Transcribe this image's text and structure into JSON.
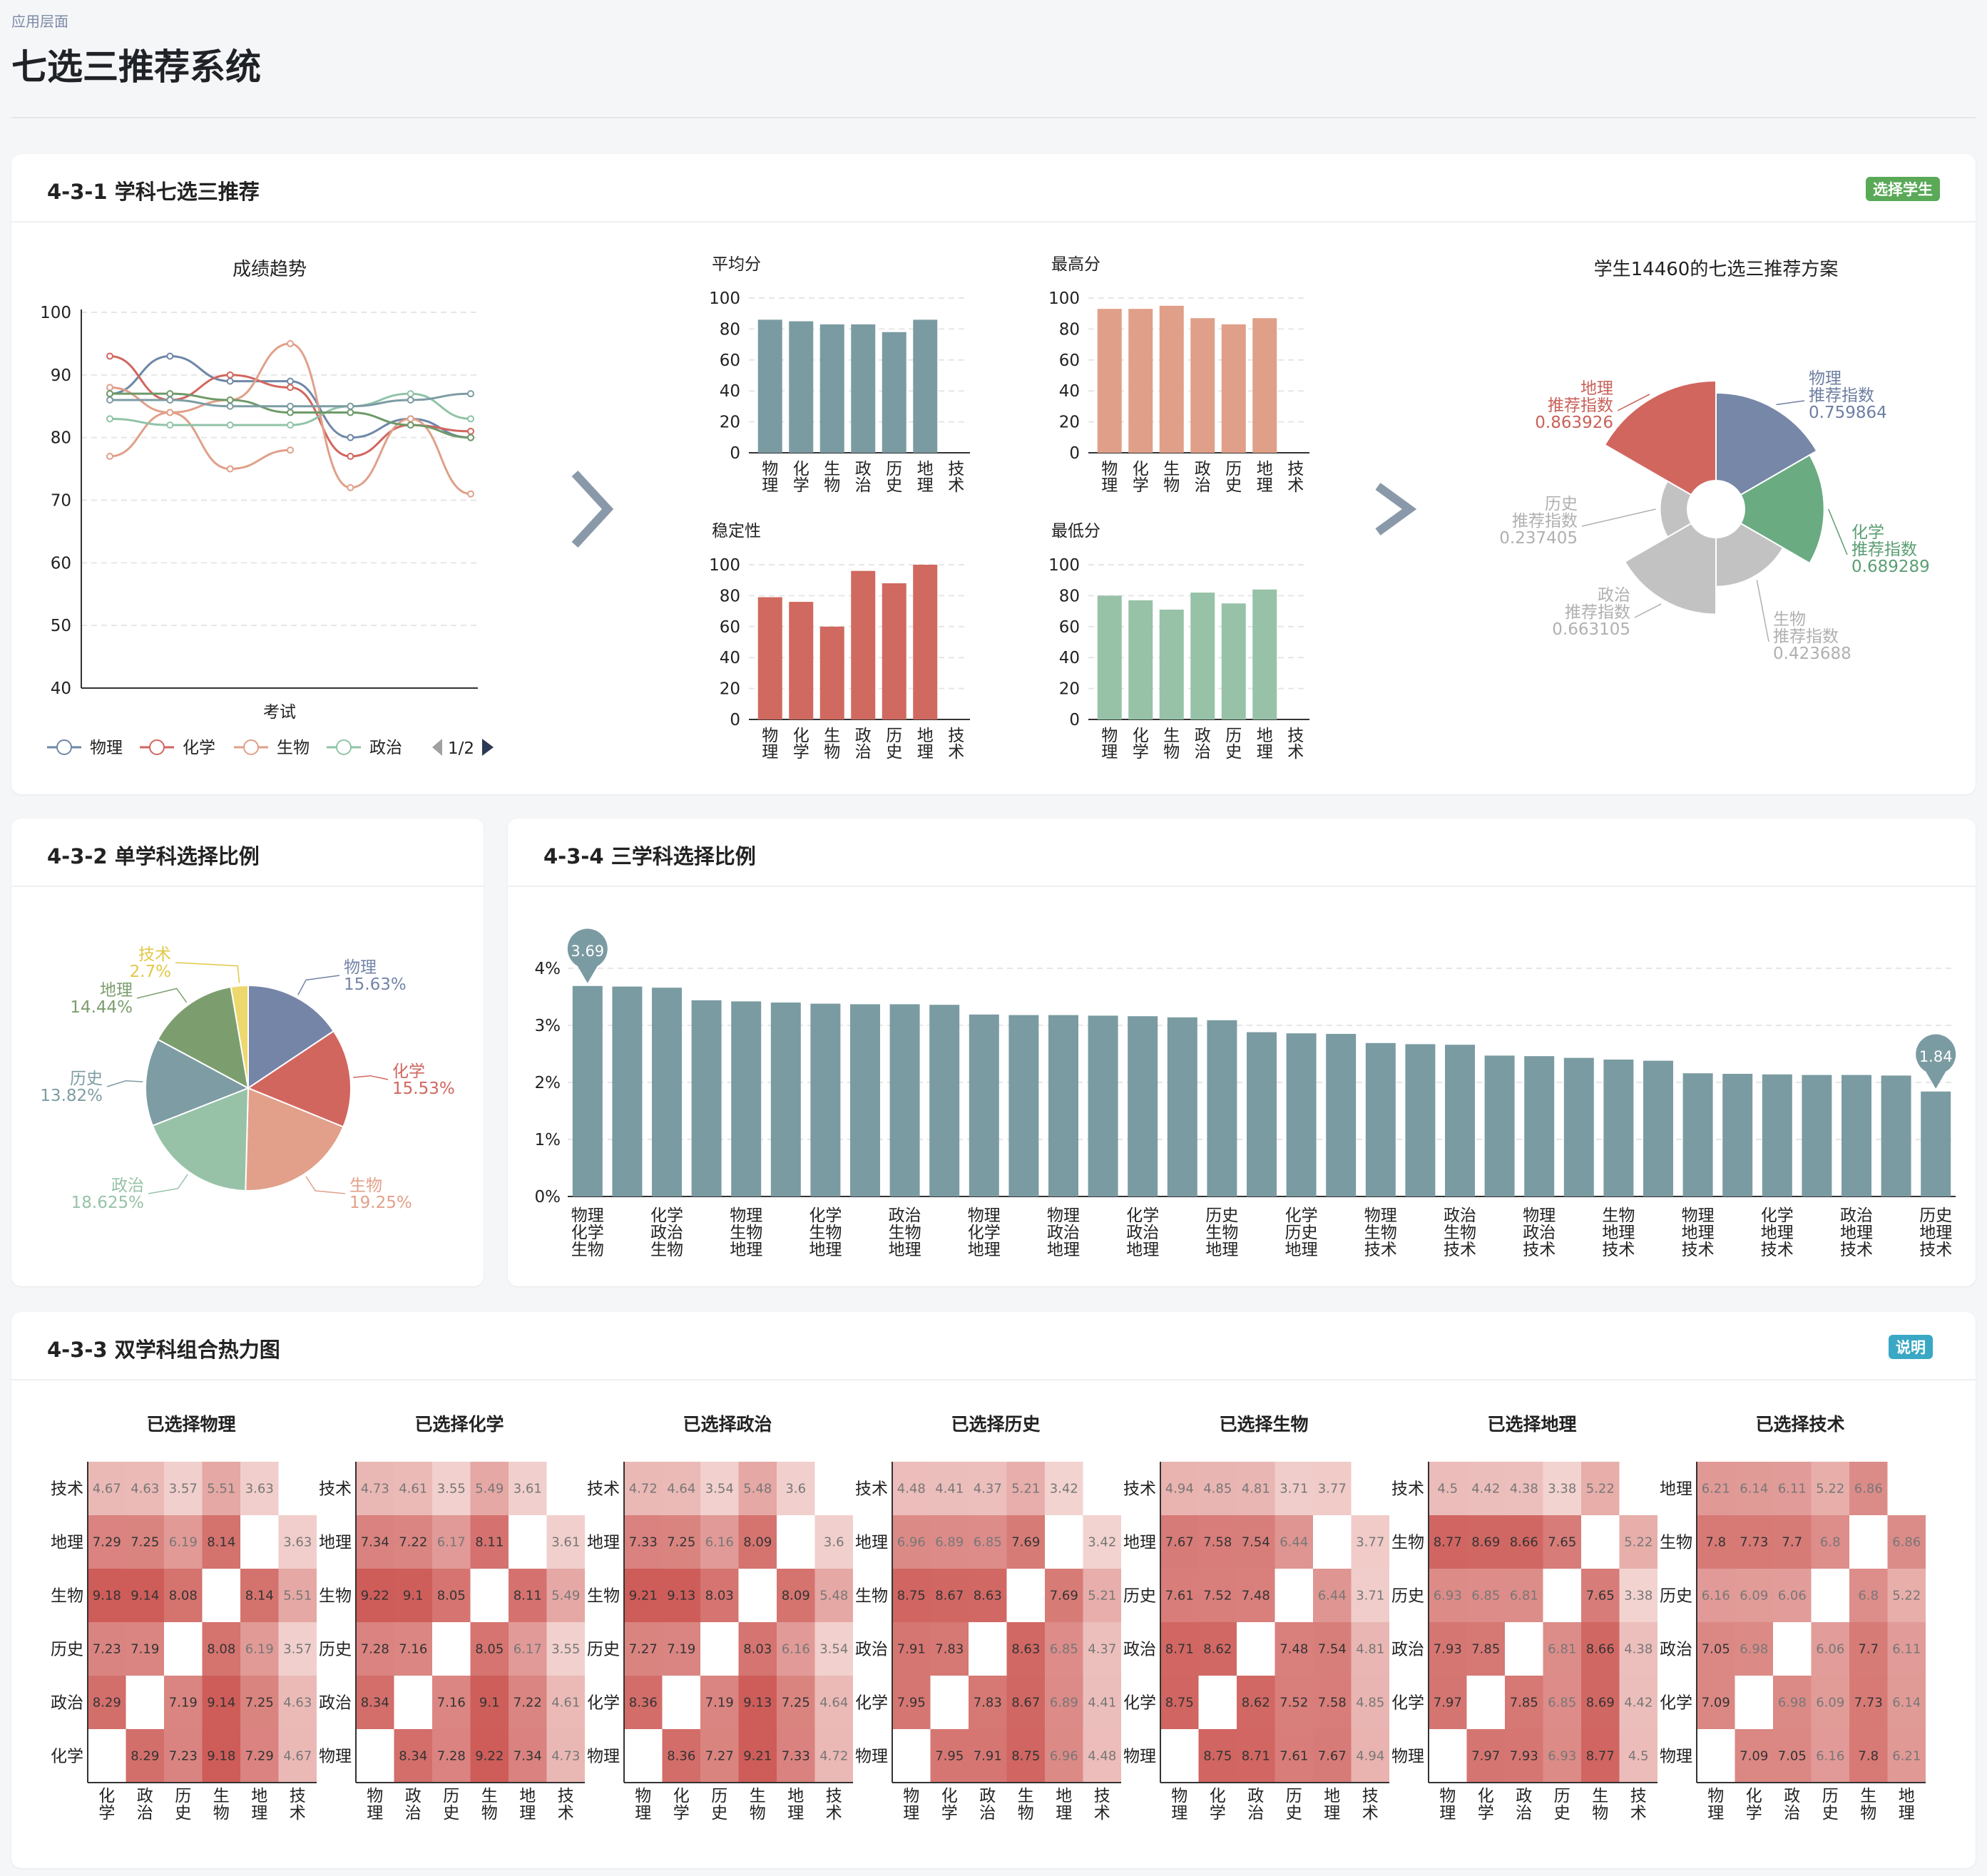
{
  "breadcrumb": "应用层面",
  "page_title": "七选三推荐系统",
  "card1": {
    "title": "4-3-1 学科七选三推荐",
    "badge": "选择学生"
  },
  "card2": {
    "title": "4-3-2 单学科选择比例"
  },
  "card4": {
    "title": "4-3-4 三学科选择比例"
  },
  "card3": {
    "title": "4-3-3 双学科组合热力图",
    "badge": "说明"
  },
  "line_chart": {
    "title": "成绩趋势",
    "xlabel": "考试",
    "legend": [
      "物理",
      "化学",
      "生物",
      "政治"
    ],
    "pager": "1/2"
  },
  "colors": {
    "物理": "#6e87a8",
    "化学": "#d1665f",
    "生物": "#e0a08a",
    "政治": "#90c3a7",
    "地理": "#6e9968",
    "历史": "#7d9ca3",
    "技术": "#ecd86d",
    "steel": "#7d9ca3"
  },
  "chart_data": [
    {
      "id": "score-trend",
      "type": "line",
      "title": "成绩趋势",
      "xlabel": "考试",
      "ylim": [
        40,
        100
      ],
      "yticks": [
        40,
        50,
        60,
        70,
        80,
        90,
        100
      ],
      "grid": true,
      "legend_placement": "bottom",
      "series": [
        {
          "name": "物理",
          "values": [
            87,
            93,
            89,
            89,
            80,
            83,
            80
          ]
        },
        {
          "name": "化学",
          "values": [
            93,
            86,
            90,
            88,
            77,
            82,
            81
          ]
        },
        {
          "name": "生物",
          "values": [
            77,
            84,
            75,
            78
          ]
        },
        {
          "name": "政治",
          "values": [
            83,
            82,
            82,
            82,
            85,
            87,
            83
          ]
        },
        {
          "name": "生物",
          "values": [
            88,
            84,
            86,
            95,
            72,
            83,
            71
          ]
        },
        {
          "name": "地理",
          "values": [
            87,
            87,
            86,
            84,
            84,
            82,
            80
          ]
        },
        {
          "name": "历史",
          "values": [
            86,
            86,
            85,
            85,
            85,
            86,
            87
          ]
        }
      ]
    },
    {
      "id": "avg",
      "type": "bar",
      "title": "平均分",
      "categories": [
        "物理",
        "化学",
        "生物",
        "政治",
        "历史",
        "地理",
        "技术"
      ],
      "values": [
        86,
        85,
        83,
        83,
        78,
        86,
        null
      ],
      "ylim": [
        0,
        100
      ],
      "yticks": [
        0,
        20,
        40,
        60,
        80,
        100
      ]
    },
    {
      "id": "max",
      "type": "bar",
      "title": "最高分",
      "categories": [
        "物理",
        "化学",
        "生物",
        "政治",
        "历史",
        "地理",
        "技术"
      ],
      "values": [
        93,
        93,
        95,
        87,
        83,
        87,
        null
      ],
      "ylim": [
        0,
        100
      ],
      "yticks": [
        0,
        20,
        40,
        60,
        80,
        100
      ]
    },
    {
      "id": "stability",
      "type": "bar",
      "title": "稳定性",
      "categories": [
        "物理",
        "化学",
        "生物",
        "政治",
        "历史",
        "地理",
        "技术"
      ],
      "values": [
        79,
        76,
        60,
        96,
        88,
        100,
        null
      ],
      "ylim": [
        0,
        100
      ],
      "yticks": [
        0,
        20,
        40,
        60,
        80,
        100
      ]
    },
    {
      "id": "min",
      "type": "bar",
      "title": "最低分",
      "categories": [
        "物理",
        "化学",
        "生物",
        "政治",
        "历史",
        "地理",
        "技术"
      ],
      "values": [
        80,
        77,
        71,
        82,
        75,
        84,
        null
      ],
      "ylim": [
        0,
        100
      ],
      "yticks": [
        0,
        20,
        40,
        60,
        80,
        100
      ]
    },
    {
      "id": "recommend-rose",
      "type": "pie",
      "title": "学生14460的七选三推荐方案",
      "caption": "推荐指数",
      "slices": [
        {
          "name": "物理",
          "value": 0.759864,
          "label": "0.759864"
        },
        {
          "name": "化学",
          "value": 0.689289,
          "label": "0.689289"
        },
        {
          "name": "生物",
          "value": 0.423688,
          "label": "0.423688"
        },
        {
          "name": "政治",
          "value": 0.663105,
          "label": "0.663105"
        },
        {
          "name": "历史",
          "value": 0.237405,
          "label": "0.237405"
        },
        {
          "name": "地理",
          "value": 0.863926,
          "label": "0.863926"
        }
      ]
    },
    {
      "id": "single-subject",
      "type": "pie",
      "slices": [
        {
          "name": "物理",
          "value": 15.63,
          "label": "15.63%"
        },
        {
          "name": "化学",
          "value": 15.53,
          "label": "15.53%"
        },
        {
          "name": "生物",
          "value": 19.25,
          "label": "19.25%"
        },
        {
          "name": "政治",
          "value": 18.625,
          "label": "18.625%"
        },
        {
          "name": "历史",
          "value": 13.82,
          "label": "13.82%"
        },
        {
          "name": "地理",
          "value": 14.44,
          "label": "14.44%"
        },
        {
          "name": "技术",
          "value": 2.7,
          "label": "2.7%"
        }
      ]
    },
    {
      "id": "triple-subject",
      "type": "bar",
      "ylim": [
        0,
        4
      ],
      "yticks": [
        "0%",
        "1%",
        "2%",
        "3%",
        "4%"
      ],
      "values": [
        3.69,
        3.68,
        3.66,
        3.44,
        3.42,
        3.4,
        3.38,
        3.37,
        3.37,
        3.36,
        3.19,
        3.18,
        3.18,
        3.17,
        3.16,
        3.14,
        3.09,
        2.88,
        2.86,
        2.85,
        2.69,
        2.67,
        2.66,
        2.47,
        2.46,
        2.43,
        2.4,
        2.38,
        2.16,
        2.15,
        2.14,
        2.13,
        2.13,
        2.12,
        1.84
      ],
      "markers": [
        {
          "index": 0,
          "label": "3.69"
        },
        {
          "index": 34,
          "label": "1.84"
        }
      ],
      "tick_labels": [
        [
          "物理",
          "化学",
          "生物"
        ],
        [
          "化学",
          "政治",
          "生物"
        ],
        [
          "物理",
          "生物",
          "地理"
        ],
        [
          "化学",
          "生物",
          "地理"
        ],
        [
          "政治",
          "生物",
          "地理"
        ],
        [
          "物理",
          "化学",
          "地理"
        ],
        [
          "物理",
          "政治",
          "地理"
        ],
        [
          "化学",
          "政治",
          "地理"
        ],
        [
          "历史",
          "生物",
          "地理"
        ],
        [
          "化学",
          "历史",
          "地理"
        ],
        [
          "物理",
          "生物",
          "技术"
        ],
        [
          "政治",
          "生物",
          "技术"
        ],
        [
          "物理",
          "政治",
          "技术"
        ],
        [
          "生物",
          "地理",
          "技术"
        ],
        [
          "物理",
          "地理",
          "技术"
        ],
        [
          "化学",
          "地理",
          "技术"
        ],
        [
          "政治",
          "地理",
          "技术"
        ],
        [
          "历史",
          "地理",
          "技术"
        ]
      ]
    },
    {
      "id": "heatmaps",
      "type": "heatmap",
      "panels": [
        {
          "title": "已选择物理",
          "rows": [
            "技术",
            "地理",
            "生物",
            "历史",
            "政治",
            "化学"
          ],
          "cols": [
            "化学",
            "政治",
            "历史",
            "生物",
            "地理",
            "技术"
          ],
          "cells": [
            [
              "4.67",
              "4.63",
              "3.57",
              "5.51",
              "3.63",
              ""
            ],
            [
              "7.29",
              "7.25",
              "6.19",
              "8.14",
              "",
              "3.63"
            ],
            [
              "9.18",
              "9.14",
              "8.08",
              "",
              "8.14",
              "5.51"
            ],
            [
              "7.23",
              "7.19",
              "",
              "8.08",
              "6.19",
              "3.57"
            ],
            [
              "8.29",
              "",
              "7.19",
              "9.14",
              "7.25",
              "4.63"
            ],
            [
              "",
              "8.29",
              "7.23",
              "9.18",
              "7.29",
              "4.67"
            ]
          ]
        },
        {
          "title": "已选择化学",
          "rows": [
            "技术",
            "地理",
            "生物",
            "历史",
            "政治",
            "物理"
          ],
          "cols": [
            "物理",
            "政治",
            "历史",
            "生物",
            "地理",
            "技术"
          ],
          "cells": [
            [
              "4.73",
              "4.61",
              "3.55",
              "5.49",
              "3.61",
              ""
            ],
            [
              "7.34",
              "7.22",
              "6.17",
              "8.11",
              "",
              "3.61"
            ],
            [
              "9.22",
              "9.1",
              "8.05",
              "",
              "8.11",
              "5.49"
            ],
            [
              "7.28",
              "7.16",
              "",
              "8.05",
              "6.17",
              "3.55"
            ],
            [
              "8.34",
              "",
              "7.16",
              "9.1",
              "7.22",
              "4.61"
            ],
            [
              "",
              "8.34",
              "7.28",
              "9.22",
              "7.34",
              "4.73"
            ]
          ]
        },
        {
          "title": "已选择政治",
          "rows": [
            "技术",
            "地理",
            "生物",
            "历史",
            "化学",
            "物理"
          ],
          "cols": [
            "物理",
            "化学",
            "历史",
            "生物",
            "地理",
            "技术"
          ],
          "cells": [
            [
              "4.72",
              "4.64",
              "3.54",
              "5.48",
              "3.6",
              ""
            ],
            [
              "7.33",
              "7.25",
              "6.16",
              "8.09",
              "",
              "3.6"
            ],
            [
              "9.21",
              "9.13",
              "8.03",
              "",
              "8.09",
              "5.48"
            ],
            [
              "7.27",
              "7.19",
              "",
              "8.03",
              "6.16",
              "3.54"
            ],
            [
              "8.36",
              "",
              "7.19",
              "9.13",
              "7.25",
              "4.64"
            ],
            [
              "",
              "8.36",
              "7.27",
              "9.21",
              "7.33",
              "4.72"
            ]
          ]
        },
        {
          "title": "已选择历史",
          "rows": [
            "技术",
            "地理",
            "生物",
            "政治",
            "化学",
            "物理"
          ],
          "cols": [
            "物理",
            "化学",
            "政治",
            "生物",
            "地理",
            "技术"
          ],
          "cells": [
            [
              "4.48",
              "4.41",
              "4.37",
              "5.21",
              "3.42",
              ""
            ],
            [
              "6.96",
              "6.89",
              "6.85",
              "7.69",
              "",
              "3.42"
            ],
            [
              "8.75",
              "8.67",
              "8.63",
              "",
              "7.69",
              "5.21"
            ],
            [
              "7.91",
              "7.83",
              "",
              "8.63",
              "6.85",
              "4.37"
            ],
            [
              "7.95",
              "",
              "7.83",
              "8.67",
              "6.89",
              "4.41"
            ],
            [
              "",
              "7.95",
              "7.91",
              "8.75",
              "6.96",
              "4.48"
            ]
          ]
        },
        {
          "title": "已选择生物",
          "rows": [
            "技术",
            "地理",
            "历史",
            "政治",
            "化学",
            "物理"
          ],
          "cols": [
            "物理",
            "化学",
            "政治",
            "历史",
            "地理",
            "技术"
          ],
          "cells": [
            [
              "4.94",
              "4.85",
              "4.81",
              "3.71",
              "3.77",
              ""
            ],
            [
              "7.67",
              "7.58",
              "7.54",
              "6.44",
              "",
              "3.77"
            ],
            [
              "7.61",
              "7.52",
              "7.48",
              "",
              "6.44",
              "3.71"
            ],
            [
              "8.71",
              "8.62",
              "",
              "7.48",
              "7.54",
              "4.81"
            ],
            [
              "8.75",
              "",
              "8.62",
              "7.52",
              "7.58",
              "4.85"
            ],
            [
              "",
              "8.75",
              "8.71",
              "7.61",
              "7.67",
              "4.94"
            ]
          ]
        },
        {
          "title": "已选择地理",
          "rows": [
            "技术",
            "生物",
            "历史",
            "政治",
            "化学",
            "物理"
          ],
          "cols": [
            "物理",
            "化学",
            "政治",
            "历史",
            "生物",
            "技术"
          ],
          "cells": [
            [
              "4.5",
              "4.42",
              "4.38",
              "3.38",
              "5.22",
              ""
            ],
            [
              "8.77",
              "8.69",
              "8.66",
              "7.65",
              "",
              "5.22"
            ],
            [
              "6.93",
              "6.85",
              "6.81",
              "",
              "7.65",
              "3.38"
            ],
            [
              "7.93",
              "7.85",
              "",
              "6.81",
              "8.66",
              "4.38"
            ],
            [
              "7.97",
              "",
              "7.85",
              "6.85",
              "8.69",
              "4.42"
            ],
            [
              "",
              "7.97",
              "7.93",
              "6.93",
              "8.77",
              "4.5"
            ]
          ]
        },
        {
          "title": "已选择技术",
          "rows": [
            "地理",
            "生物",
            "历史",
            "政治",
            "化学",
            "物理"
          ],
          "cols": [
            "物理",
            "化学",
            "政治",
            "历史",
            "生物",
            "地理"
          ],
          "cells": [
            [
              "6.21",
              "6.14",
              "6.11",
              "5.22",
              "6.86",
              ""
            ],
            [
              "7.8",
              "7.73",
              "7.7",
              "6.8",
              "",
              "6.86"
            ],
            [
              "6.16",
              "6.09",
              "6.06",
              "",
              "6.8",
              "5.22"
            ],
            [
              "7.05",
              "6.98",
              "",
              "6.06",
              "7.7",
              "6.11"
            ],
            [
              "7.09",
              "",
              "6.98",
              "6.09",
              "7.73",
              "6.14"
            ],
            [
              "",
              "7.09",
              "7.05",
              "6.16",
              "7.8",
              "6.21"
            ]
          ]
        }
      ]
    }
  ]
}
